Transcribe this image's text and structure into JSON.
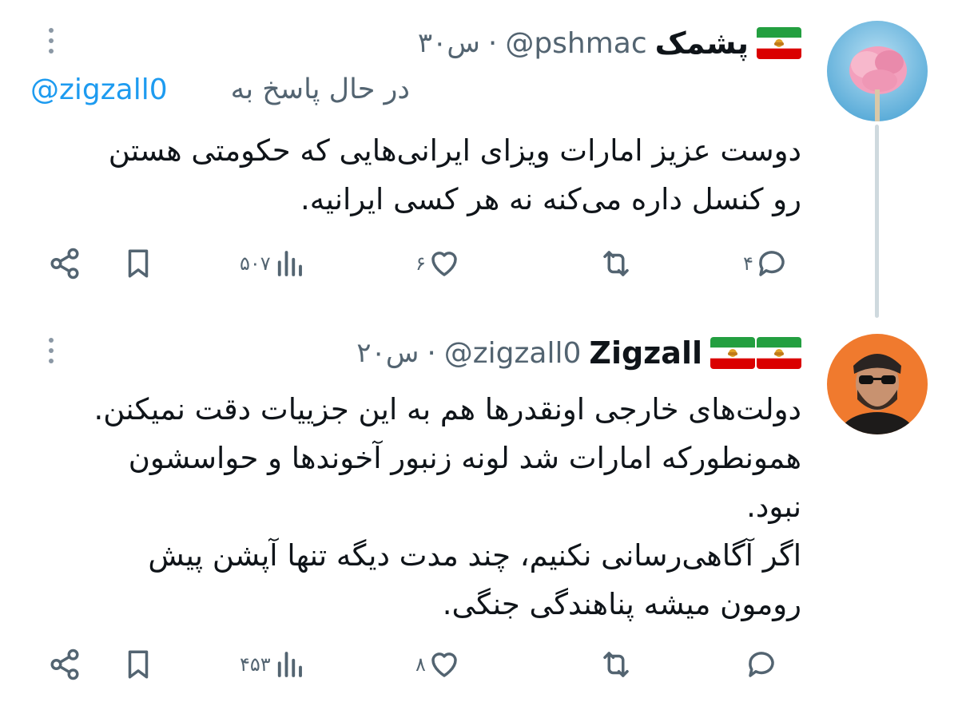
{
  "tweets": [
    {
      "display_name": "پشمک",
      "handle": "@pshmac",
      "separator": "·",
      "time": "۳۰س",
      "replying_to_label": "در حال پاسخ به",
      "replying_to_handle": "@zigzall0",
      "text_lines": [
        "دوست عزیز امارات ویزای ایرانی‌هایی که حکومتی هستن",
        "رو کنسل داره می‌کنه نه هر کسی ایرانیه."
      ],
      "counts": {
        "reply": "۴",
        "retweet": "",
        "like": "۶",
        "views": "۵۰۷"
      },
      "avatar_icon": "cotton-candy-photo"
    },
    {
      "display_name": "Zigzall",
      "handle": "@zigzall0",
      "separator": "·",
      "time": "۲۰س",
      "text_lines": [
        "دولت‌های خارجی اونقدرها هم به این جزییات دقت نمیکنن.",
        "همونطورکه امارات شد لونه زنبور آخوندها و حواسشون",
        "نبود.",
        " اگر آگاهی‌رسانی نکنیم، چند مدت دیگه تنها آپشن پیش",
        "رومون میشه پناهندگی جنگی."
      ],
      "counts": {
        "reply": "",
        "retweet": "",
        "like": "۸",
        "views": "۴۵۳"
      },
      "avatar_icon": "man-sunglasses-photo"
    }
  ],
  "colors": {
    "text": "#0f1419",
    "secondary": "#536471",
    "link": "#1d9bf0",
    "thread_line": "#cfd9de"
  },
  "icons": [
    "more-icon",
    "reply-icon",
    "retweet-icon",
    "like-icon",
    "views-icon",
    "bookmark-icon",
    "share-icon",
    "iran-lion-sun-flag-icon"
  ]
}
